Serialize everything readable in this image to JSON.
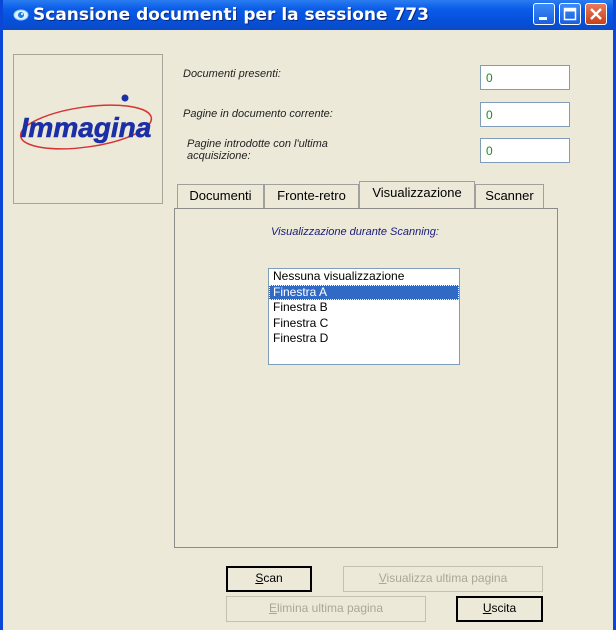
{
  "window": {
    "title": "Scansione documenti per la sessione 773",
    "icon": "app-eye-icon"
  },
  "logo": {
    "text": "Immagina",
    "color": "#1b2fa6"
  },
  "fields": [
    {
      "label": "Documenti presenti:",
      "value": "0"
    },
    {
      "label": "Pagine in documento corrente:",
      "value": "0"
    },
    {
      "label": "Pagine introdotte con l'ultima acquisizione:",
      "value": "0"
    }
  ],
  "tabs": [
    {
      "label": "Documenti",
      "active": false
    },
    {
      "label": "Fronte-retro",
      "active": false
    },
    {
      "label": "Visualizzazione",
      "active": true
    },
    {
      "label": "Scanner",
      "active": false
    }
  ],
  "panel": {
    "caption": "Visualizzazione durante Scanning:",
    "options": [
      "Nessuna visualizzazione",
      "Finestra A",
      "Finestra B",
      "Finestra C",
      "Finestra D"
    ],
    "selected": "Finestra A"
  },
  "buttons": {
    "scan": {
      "label": "Scan",
      "mnemonic": "S",
      "rest": "can",
      "enabled": true
    },
    "view_last": {
      "label": "Visualizza ultima pagina",
      "mnemonic": "V",
      "rest": "isualizza ultima pagina",
      "enabled": false
    },
    "delete_last": {
      "label": "Elimina ultima pagina",
      "mnemonic": "E",
      "rest": "limina ultima pagina",
      "enabled": false
    },
    "exit": {
      "label": "Uscita",
      "mnemonic": "U",
      "rest": "scita",
      "enabled": true
    }
  }
}
